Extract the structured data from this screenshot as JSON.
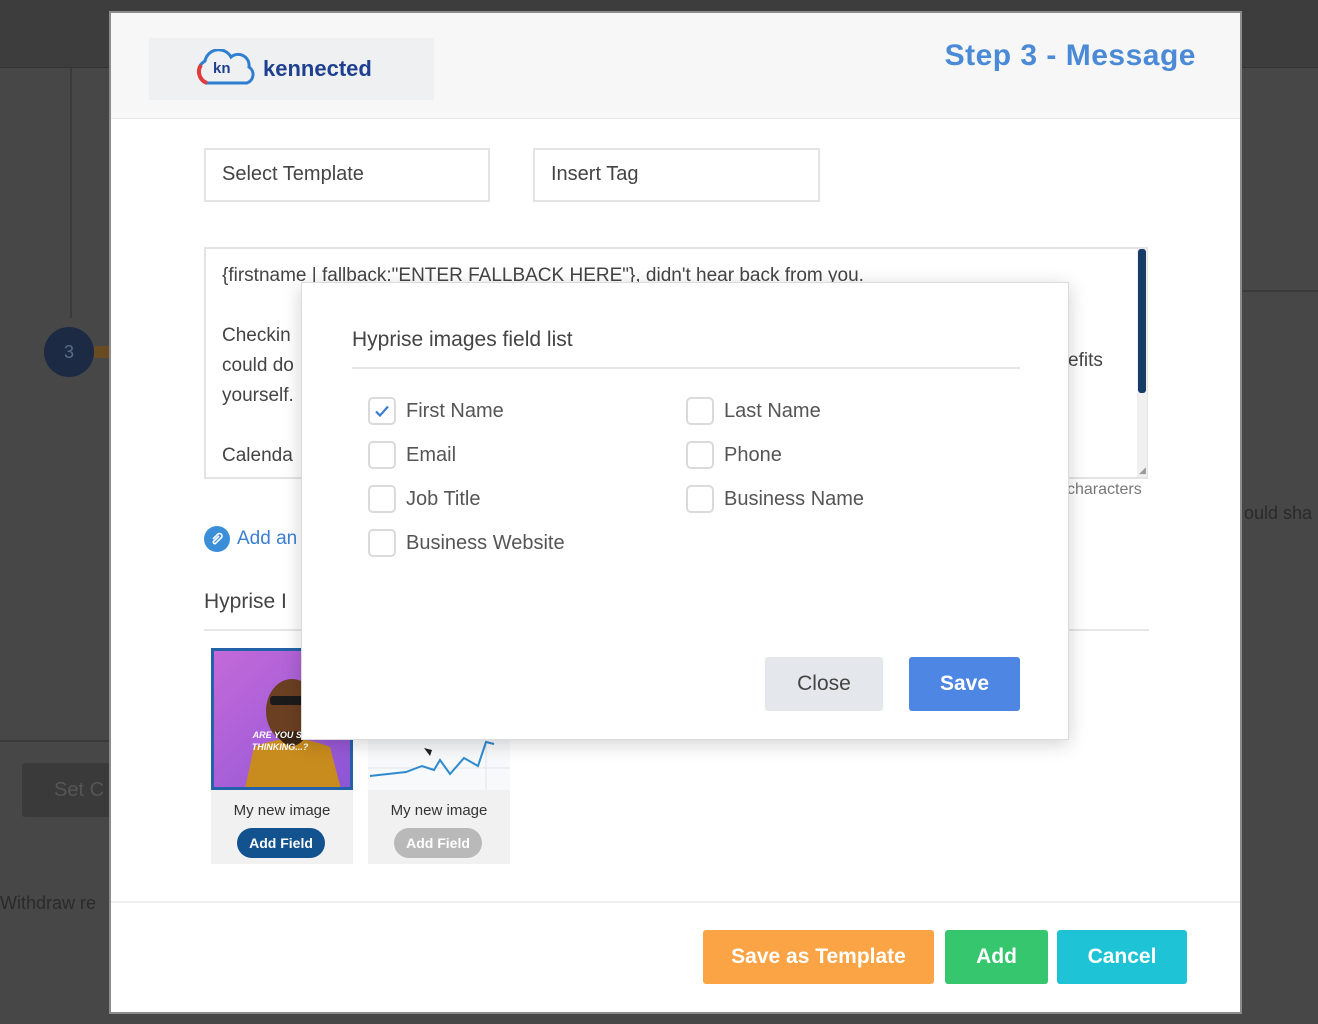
{
  "background": {
    "step_number": "3",
    "partial_button": "Set C",
    "partial_text_left": "Withdraw re",
    "partial_text_right": "ould sha"
  },
  "header": {
    "logo_badge": "kn",
    "logo_text": "kennected",
    "step_title": "Step 3 - Message"
  },
  "fields": {
    "select_template": "Select Template",
    "insert_tag": "Insert Tag"
  },
  "message": {
    "lines": [
      "{firstname | fallback:\"ENTER FALLBACK HERE\"}, didn't hear back from you.",
      "",
      "Checkin",
      "could do",
      "yourself.",
      "",
      "Calenda"
    ],
    "partial_right": "efits",
    "char_count_label": "characters"
  },
  "add_attachment": "Add an",
  "hyprise_section": {
    "label": "Hyprise I",
    "images": [
      {
        "caption": "My new image",
        "button": "Add Field",
        "selected": true,
        "overlay_text": "ARE YOU ST THINKING...?"
      },
      {
        "caption": "My new image",
        "button": "Add Field",
        "selected": false
      }
    ]
  },
  "dialog": {
    "title": "Hyprise images field list",
    "fields": [
      {
        "label": "First Name",
        "checked": true
      },
      {
        "label": "Last Name",
        "checked": false
      },
      {
        "label": "Email",
        "checked": false
      },
      {
        "label": "Phone",
        "checked": false
      },
      {
        "label": "Job Title",
        "checked": false
      },
      {
        "label": "Business Name",
        "checked": false
      },
      {
        "label": "Business Website",
        "checked": false
      }
    ],
    "close_label": "Close",
    "save_label": "Save"
  },
  "footer": {
    "save_template_label": "Save as Template",
    "add_label": "Add",
    "cancel_label": "Cancel"
  },
  "colors": {
    "accent_blue": "#4a8ad6",
    "save_blue": "#4e86e4",
    "orange": "#fba445",
    "green": "#36c66e",
    "cyan": "#1ec4d6",
    "navy": "#163b66"
  }
}
